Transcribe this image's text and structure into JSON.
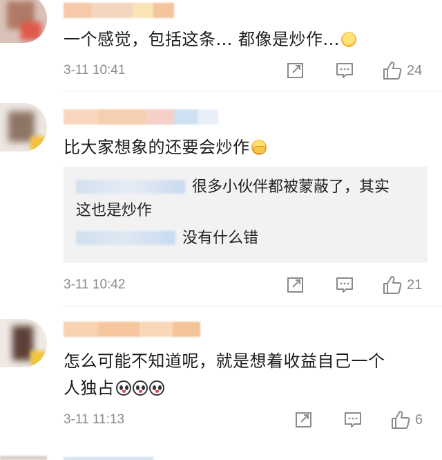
{
  "comments": [
    {
      "text": "一个感觉，包括这条... 都像是炒作...",
      "emoji": "thinking-face-emoji",
      "date": "3-11 10:41",
      "likes": "24"
    },
    {
      "text": "比大家想象的还要会炒作",
      "emoji": "face-covering-mouth-emoji",
      "replies": [
        {
          "text": "很多小伙伴都被蒙蔽了，其实",
          "text_cont": "这也是炒作"
        },
        {
          "text": "没有什么错"
        }
      ],
      "date": "3-11 10:42",
      "likes": "21"
    },
    {
      "text_line1": "怎么可能不知道呢，就是想着收益自己一个",
      "text_line2": "人独占",
      "emoji": "panda-emoji",
      "date": "3-11 11:13",
      "likes": "6"
    }
  ],
  "icons": {
    "share": "share-icon",
    "comment": "comment-icon",
    "like": "thumbs-up-icon"
  },
  "colors": {
    "meta_text": "#8a8a8a",
    "separator": "#ececec",
    "quote_bg": "#f2f2f2"
  }
}
